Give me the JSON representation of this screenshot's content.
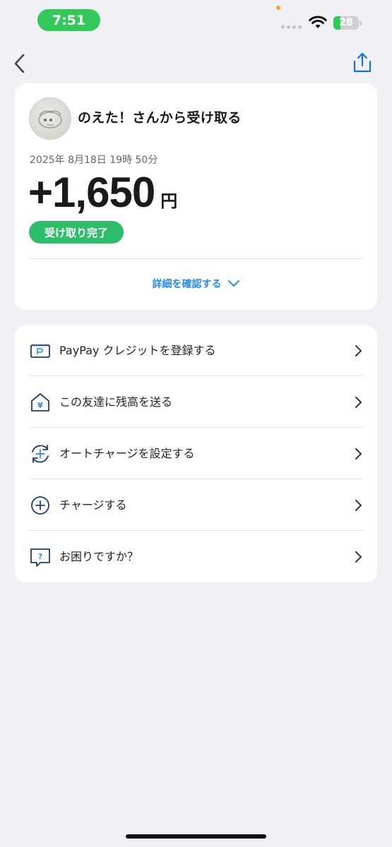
{
  "status_bar": {
    "time": "7:51",
    "battery_level": "28"
  },
  "nav": {
    "back_icon": "chevron-left-icon",
    "share_icon": "share-icon"
  },
  "transaction": {
    "title": "のえた！さんから受け取る",
    "date": "2025年 8月18日 19時 50分",
    "amount": "+1,650",
    "currency": "円",
    "status": "受け取り完了",
    "details_label": "詳細を確認する"
  },
  "menu": {
    "items": [
      {
        "label": "PayPay クレジットを登録する",
        "icon": "credit-card-icon"
      },
      {
        "label": "この友達に残高を送る",
        "icon": "send-yen-icon"
      },
      {
        "label": "オートチャージを設定する",
        "icon": "auto-charge-icon"
      },
      {
        "label": "チャージする",
        "icon": "plus-circle-icon"
      },
      {
        "label": "お困りですか？",
        "icon": "help-question-icon"
      }
    ]
  },
  "colors": {
    "accent_blue": "#2d8ae0",
    "success_green": "#2ebd6c",
    "icon_navy": "#1d3c6e",
    "background": "#f0f1f5"
  }
}
